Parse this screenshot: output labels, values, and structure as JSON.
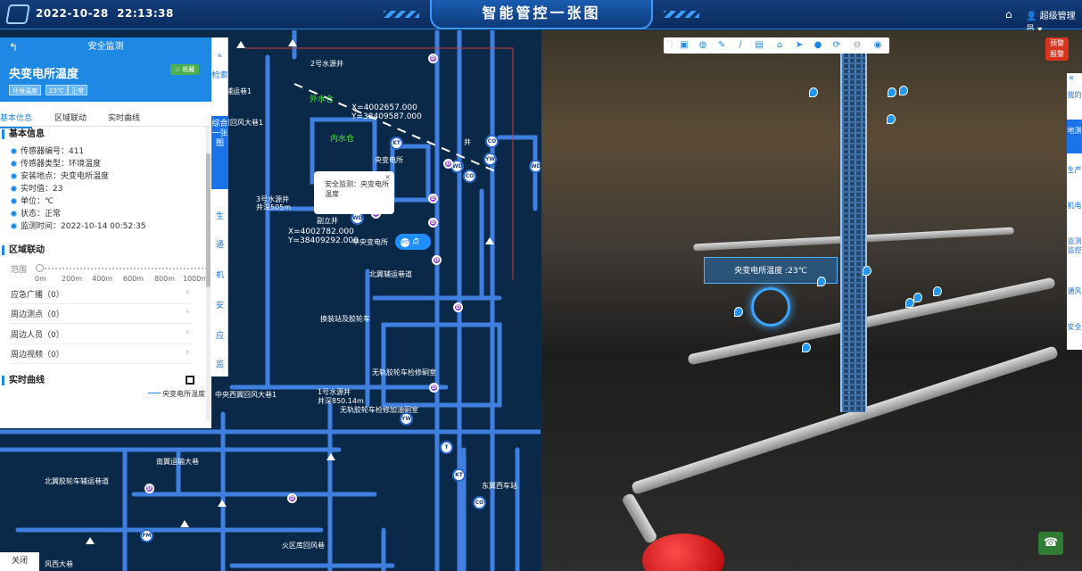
{
  "header": {
    "date": "2022-10-28",
    "time": "22:13:38",
    "title": "智能管控一张图",
    "user": "超级管理员"
  },
  "panel": {
    "back_label": "安全监测",
    "title": "央变电所温度",
    "fav": "☆ 收藏",
    "tags": [
      "环境温度",
      "23℃",
      "正常"
    ],
    "tabs": [
      "基本信息",
      "区域联动",
      "实时曲线"
    ],
    "basic_title": "基本信息",
    "info": [
      "传感器编号：411",
      "传感器类型：环境温度",
      "安装地点：央变电所温度",
      "实时值：23",
      "单位：℃",
      "状态：正常",
      "监测时间：2022-10-14 00:52:35"
    ],
    "link_title": "区域联动",
    "range_label": "范围",
    "ticks": [
      "0m",
      "200m",
      "400m",
      "600m",
      "800m",
      "1000m"
    ],
    "links": [
      "应急广播（0）",
      "周边测点（0）",
      "周边人员（0）",
      "周边视频（0）"
    ],
    "curve_title": "实时曲线",
    "legend": "央变电所温度",
    "close": "关闭"
  },
  "bookmarks": [
    {
      "t": "检索",
      "active": false
    },
    {
      "t": "综合一张图",
      "active": true
    },
    {
      "t": "地",
      "active": false
    },
    {
      "t": "生",
      "active": false
    },
    {
      "t": "通",
      "active": false
    },
    {
      "t": "机",
      "active": false
    },
    {
      "t": "安",
      "active": false
    },
    {
      "t": "应",
      "active": false
    },
    {
      "t": "监",
      "active": false
    }
  ],
  "map": {
    "labels": [
      "2号水源井",
      "北辅运巷1",
      "南翼回风大巷1",
      "外水仓",
      "内水仓",
      "3号水源井",
      "井深505m",
      "副立井",
      "中央变电所",
      "北翼辅运巷道",
      "换装站及胶轮车",
      "无轨胶轮车检修硐室",
      "中央西翼回风大巷1",
      "1号水源井",
      "井深850.14m",
      "无轨胶轮车检修加油硐室",
      "南翼运输大巷",
      "东翼西车站",
      "北翼胶轮车辅运巷道",
      "火区库回风巷",
      "风西大巷",
      "井",
      "央变电所"
    ],
    "coords": [
      "X=4002657.000",
      "Y=38409587.000",
      "X=4002782.000",
      "Y=38409292.000"
    ],
    "popup": "安全监测：央变电所温度",
    "pin": "点"
  },
  "view3d": {
    "label": "央变电所温度 :23℃",
    "alarm": [
      "预警",
      "报警"
    ],
    "tools": [
      "fit-icon",
      "globe-icon",
      "pen-icon",
      "line-icon",
      "area-icon",
      "building-icon",
      "navigate-icon",
      "sphere-icon",
      "rotate-icon",
      "minus-icon",
      "target-icon"
    ]
  },
  "rtabs": [
    {
      "t": "我的",
      "active": false
    },
    {
      "t": "地测",
      "active": true
    },
    {
      "t": "生产",
      "active": false
    },
    {
      "t": "机电",
      "active": false
    },
    {
      "t": "监测监控",
      "active": false
    },
    {
      "t": "通风",
      "active": false
    },
    {
      "t": "安全",
      "active": false
    }
  ]
}
